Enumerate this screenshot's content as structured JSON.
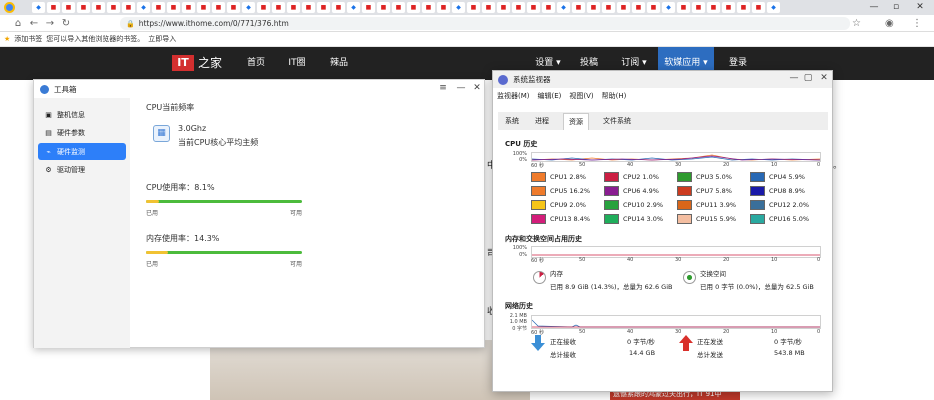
{
  "browser": {
    "url": "https://www.ithome.com/0/771/376.htm",
    "bookmark_hint": "添加书签",
    "bookmark_import": "您可以导入其他浏览器的书签。",
    "import_link": "立即导入"
  },
  "site": {
    "logo": "IT",
    "logo_suffix": "之家",
    "nav_left": [
      "首页",
      "IT圈",
      "辣品"
    ],
    "nav_right": [
      "设置",
      "投稿",
      "订阅",
      "软媒应用",
      "登录"
    ],
    "headline": "遗憾紧跟的鸿蒙过关出行，IT 91中"
  },
  "toolbox": {
    "title": "工具箱",
    "sidebar": [
      "整机信息",
      "硬件参数",
      "硬件监测",
      "驱动管理"
    ],
    "cpu_freq_title": "CPU当前频率",
    "cpu_freq_value": "3.0Ghz",
    "cpu_freq_desc": "当前CPU核心平均主频",
    "cpu_usage_label": "CPU使用率：8.1%",
    "cpu_usage": 0.081,
    "mem_usage_label": "内存使用率：14.3%",
    "mem_usage": 0.143,
    "used_label": "已用",
    "avail_label": "可用"
  },
  "sysmon": {
    "title": "系统监视器",
    "menu": [
      "监视器(M)",
      "编辑(E)",
      "视图(V)",
      "帮助(H)"
    ],
    "tabs": [
      "系统",
      "进程",
      "资源",
      "文件系统"
    ],
    "cpu_section": "CPU 历史",
    "cpu_y": [
      "100%",
      "0%"
    ],
    "x_ticks": [
      "60 秒",
      "50",
      "40",
      "30",
      "20",
      "10",
      "0"
    ],
    "cpus": [
      {
        "name": "CPU1",
        "val": "2.8%",
        "color": "#ef7b2b"
      },
      {
        "name": "CPU2",
        "val": "1.0%",
        "color": "#cc1f43"
      },
      {
        "name": "CPU3",
        "val": "5.0%",
        "color": "#2e9b2e"
      },
      {
        "name": "CPU4",
        "val": "5.9%",
        "color": "#2768b4"
      },
      {
        "name": "CPU5",
        "val": "16.2%",
        "color": "#ef7b2b"
      },
      {
        "name": "CPU6",
        "val": "4.9%",
        "color": "#8a1d91"
      },
      {
        "name": "CPU7",
        "val": "5.8%",
        "color": "#cc3b1f"
      },
      {
        "name": "CPU8",
        "val": "8.9%",
        "color": "#1a1aa8"
      },
      {
        "name": "CPU9",
        "val": "2.0%",
        "color": "#f5c518"
      },
      {
        "name": "CPU10",
        "val": "2.9%",
        "color": "#28a23e"
      },
      {
        "name": "CPU11",
        "val": "3.9%",
        "color": "#d9661a"
      },
      {
        "name": "CPU12",
        "val": "2.0%",
        "color": "#3a6f9a"
      },
      {
        "name": "CPU13",
        "val": "8.4%",
        "color": "#d31d7a"
      },
      {
        "name": "CPU14",
        "val": "3.0%",
        "color": "#1fae5b"
      },
      {
        "name": "CPU15",
        "val": "5.9%",
        "color": "#f4bea1"
      },
      {
        "name": "CPU16",
        "val": "5.0%",
        "color": "#2aa9a0"
      }
    ],
    "mem_section": "内存和交换空间占用历史",
    "mem_y": [
      "100%",
      "0%"
    ],
    "mem_label": "内存",
    "mem_detail": "已用 8.9 GiB (14.3%)，总量为 62.6 GiB",
    "swap_label": "交换空间",
    "swap_detail": "已用 0 字节 (0.0%)，总量为 62.5 GiB",
    "net_section": "网络历史",
    "net_y": [
      "2.1 MB",
      "1.0 MB",
      "0 字节"
    ],
    "recv_label": "正在接收",
    "recv_rate": "0 字节/秒",
    "recv_total_label": "总计接收",
    "recv_total": "14.4 GB",
    "send_label": "正在发送",
    "send_rate": "0 字节/秒",
    "send_total_label": "总计发送",
    "send_total": "543.8 MB"
  }
}
